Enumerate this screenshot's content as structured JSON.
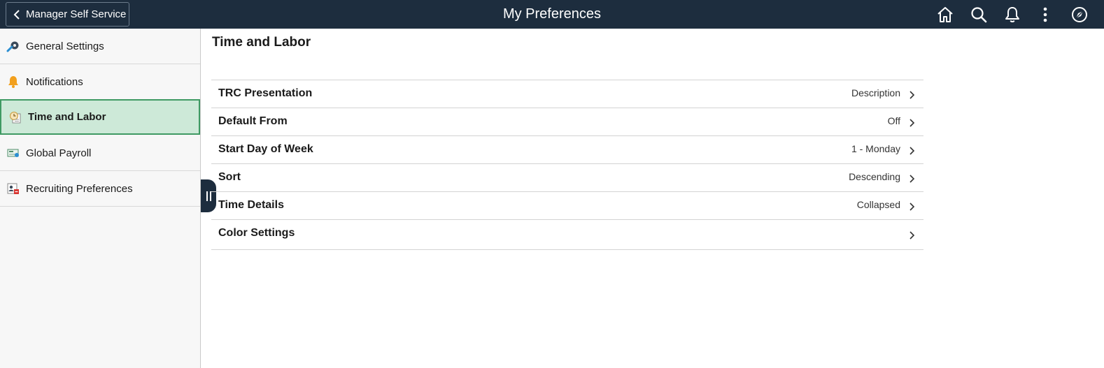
{
  "header": {
    "back_label": "Manager Self Service",
    "title": "My Preferences",
    "icons": [
      "home-icon",
      "search-icon",
      "bell-icon",
      "more-vertical-icon",
      "compass-icon"
    ]
  },
  "sidebar": {
    "items": [
      {
        "label": "General Settings",
        "icon": "wrench-gear-icon",
        "active": false
      },
      {
        "label": "Notifications",
        "icon": "bell-icon",
        "active": false
      },
      {
        "label": "Time and Labor",
        "icon": "clock-document-icon",
        "active": true
      },
      {
        "label": "Global Payroll",
        "icon": "payroll-check-icon",
        "active": false
      },
      {
        "label": "Recruiting Preferences",
        "icon": "recruiting-badge-icon",
        "active": false
      }
    ]
  },
  "main": {
    "title": "Time and Labor",
    "rows": [
      {
        "label": "TRC Presentation",
        "value": "Description"
      },
      {
        "label": "Default From",
        "value": "Off"
      },
      {
        "label": "Start Day of Week",
        "value": "1 - Monday"
      },
      {
        "label": "Sort",
        "value": "Descending"
      },
      {
        "label": "Time Details",
        "value": "Collapsed"
      },
      {
        "label": "Color Settings",
        "value": ""
      }
    ]
  },
  "colors": {
    "header_bg": "#1d2d3e",
    "active_bg": "#cde9d8",
    "active_border": "#3f9a63"
  }
}
